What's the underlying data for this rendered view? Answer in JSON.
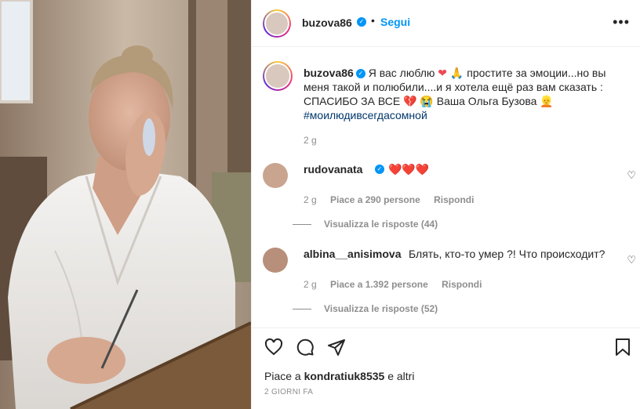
{
  "header": {
    "username": "buzova86",
    "separator": "•",
    "follow_label": "Segui",
    "more_label": "•••"
  },
  "caption": {
    "username": "buzova86",
    "text_part1": "Я вас люблю",
    "text_part2": "простите за эмоции...но вы меня такой и полюбили....и я хотела ещё раз вам сказать : СПАСИБО ЗА ВСЕ",
    "text_part3": "Ваша Ольга Бузова",
    "hashtag": "#моилюдивсегдасомной",
    "time": "2 g"
  },
  "comments": [
    {
      "username": "rudovanata",
      "text": "❤️❤️❤️",
      "time": "2 g",
      "likes": "Piace a 290 persone",
      "reply": "Rispondi",
      "view_replies": "Visualizza le risposte (44)"
    },
    {
      "username": "albina__anisimova",
      "text": "Блять, кто-то умер ?! Что происходит?",
      "time": "2 g",
      "likes": "Piace a 1.392 persone",
      "reply": "Rispondi",
      "view_replies": "Visualizza le risposte (52)"
    }
  ],
  "footer": {
    "likes_prefix": "Piace a",
    "likes_user": "kondratiuk8535",
    "likes_suffix": "e altri",
    "date": "2 GIORNI FA"
  },
  "icons": {
    "verified": "verified-badge-icon",
    "heart": "heart-icon",
    "comment": "comment-icon",
    "share": "share-icon",
    "save": "bookmark-icon",
    "more": "more-options-icon"
  },
  "colors": {
    "accent": "#0095f6",
    "text": "#262626",
    "muted": "#8e8e8e",
    "hashtag": "#00376b",
    "heart": "#ed4956"
  }
}
